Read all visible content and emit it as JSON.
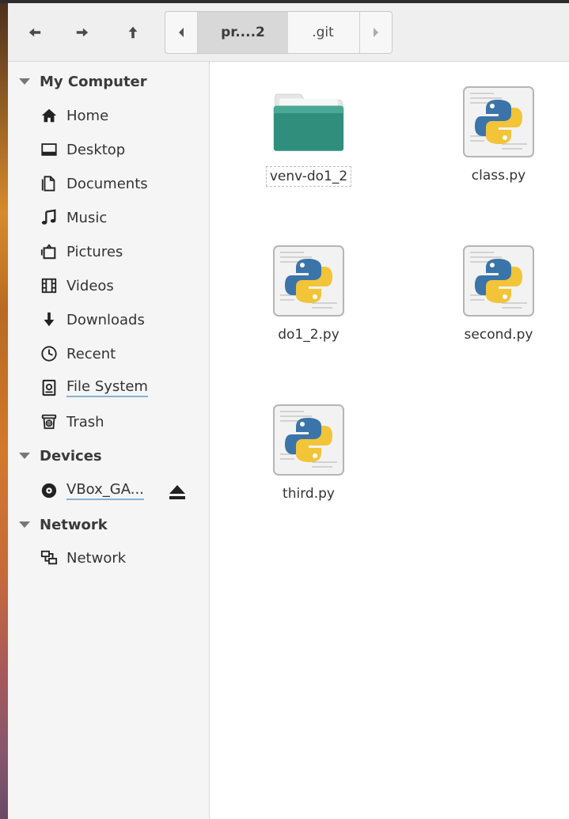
{
  "toolbar": {
    "back_icon": "arrow-left-icon",
    "forward_icon": "arrow-right-icon",
    "up_icon": "arrow-up-icon",
    "path": {
      "crumbs": [
        "pr....2",
        ".git"
      ],
      "active_index": 0
    }
  },
  "sidebar": {
    "sections": [
      {
        "title": "My Computer",
        "items": [
          {
            "label": "Home",
            "icon": "home-icon"
          },
          {
            "label": "Desktop",
            "icon": "desktop-icon"
          },
          {
            "label": "Documents",
            "icon": "documents-icon"
          },
          {
            "label": "Music",
            "icon": "music-icon"
          },
          {
            "label": "Pictures",
            "icon": "pictures-icon"
          },
          {
            "label": "Videos",
            "icon": "videos-icon"
          },
          {
            "label": "Downloads",
            "icon": "downloads-icon"
          },
          {
            "label": "Recent",
            "icon": "recent-icon"
          },
          {
            "label": "File System",
            "icon": "drive-icon"
          },
          {
            "label": "Trash",
            "icon": "trash-icon"
          }
        ]
      },
      {
        "title": "Devices",
        "items": [
          {
            "label": "VBox_GA...",
            "icon": "disc-icon",
            "eject_icon": "eject-icon"
          }
        ]
      },
      {
        "title": "Network",
        "items": [
          {
            "label": "Network",
            "icon": "network-icon"
          }
        ]
      }
    ]
  },
  "content": {
    "files": [
      {
        "name": "venv-do1_2",
        "type": "folder",
        "icon": "folder-icon"
      },
      {
        "name": "class.py",
        "type": "python",
        "icon": "python-file-icon"
      },
      {
        "name": "do1_2.py",
        "type": "python",
        "icon": "python-file-icon"
      },
      {
        "name": "second.py",
        "type": "python",
        "icon": "python-file-icon"
      },
      {
        "name": "third.py",
        "type": "python",
        "icon": "python-file-icon"
      }
    ]
  },
  "colors": {
    "folder": "#2f8f7c",
    "python_blue": "#3b74a8",
    "python_yellow": "#f2c438",
    "link_underline": "#8ab0d0"
  }
}
